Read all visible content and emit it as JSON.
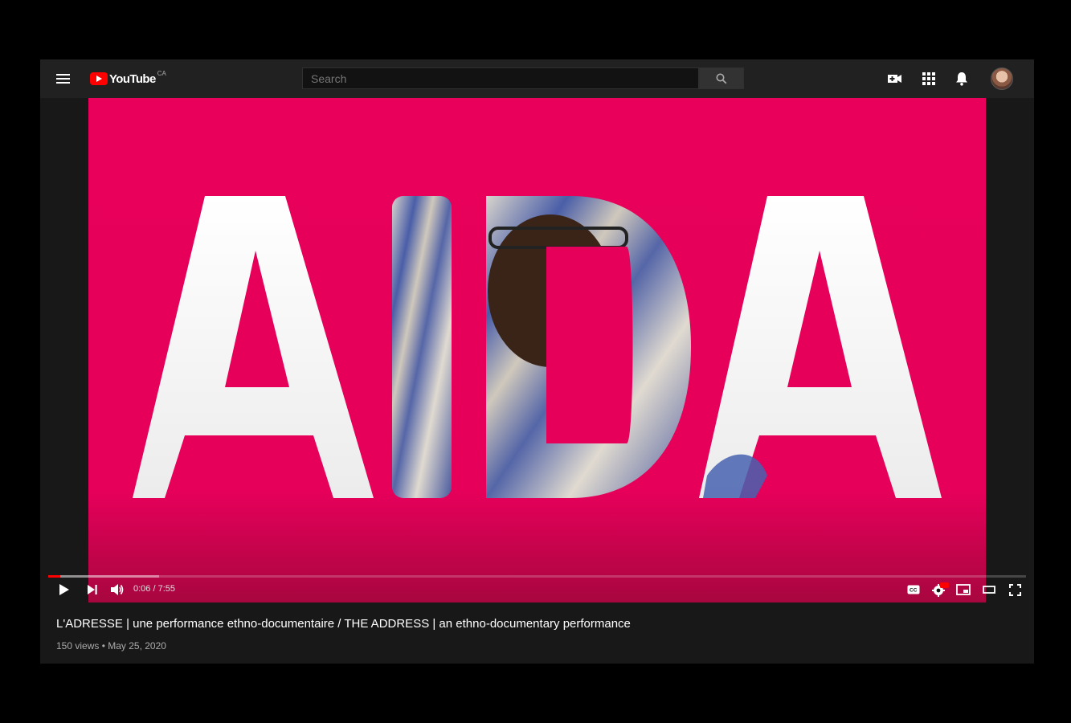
{
  "app": {
    "logo_text": "YouTube",
    "region": "CA"
  },
  "search": {
    "placeholder": "Search"
  },
  "header_icons": [
    "create-video-icon",
    "apps-grid-icon",
    "notifications-bell-icon",
    "account-avatar"
  ],
  "video": {
    "overlay_text": "AIDA",
    "background_color": "#e6005a",
    "current_time": "0:06",
    "duration": "7:55",
    "time_display": "0:06 / 7:55",
    "progress_fraction": 0.0127,
    "buffered_fraction": 0.113
  },
  "controls": {
    "left": [
      "play-icon",
      "next-icon",
      "volume-icon"
    ],
    "right": [
      "captions-icon",
      "settings-hd-icon",
      "miniplayer-icon",
      "theater-mode-icon",
      "fullscreen-icon"
    ],
    "hd_badge": "HD"
  },
  "info": {
    "title": "L'ADRESSE | une performance ethno-documentaire / THE ADDRESS | an ethno-documentary performance",
    "views": "150 views",
    "date": "May 25, 2020",
    "meta": "150 views • May 25, 2020"
  },
  "colors": {
    "accent": "#ff0000",
    "header_bg": "#212121",
    "page_bg": "#181818"
  }
}
